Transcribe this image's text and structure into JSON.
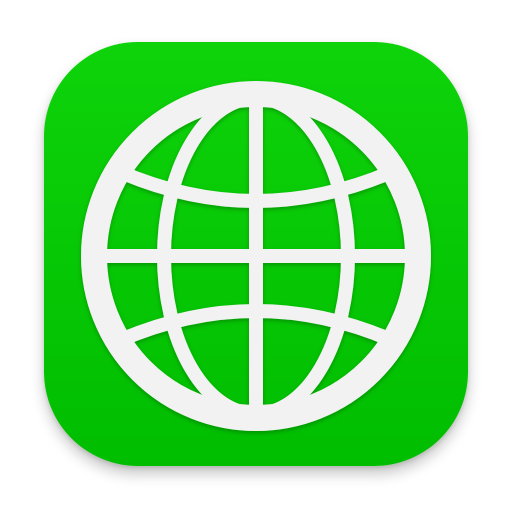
{
  "app_icon": {
    "name": "globe-app-icon",
    "icon": "globe-icon",
    "colors": {
      "background_top": "#0ed30a",
      "background_bottom": "#00bd00",
      "globe_fill": "#f2f2f2",
      "globe_stroke": "#e4e4e4"
    }
  }
}
